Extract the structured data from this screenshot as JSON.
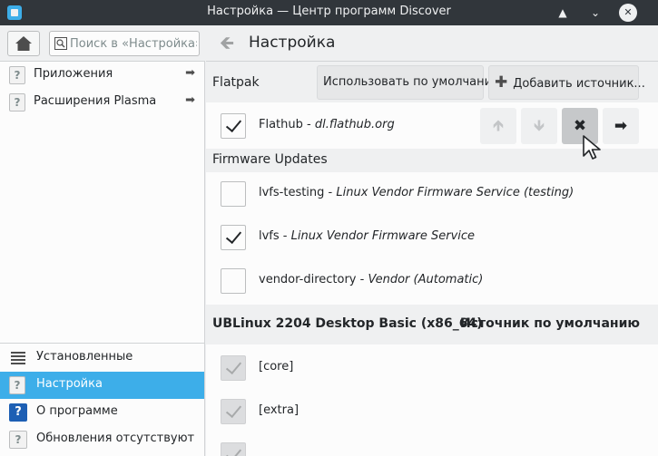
{
  "window": {
    "title": "Настройка — Центр программ Discover",
    "controls": [
      "▲",
      "⌄",
      "✕"
    ]
  },
  "sidebar": {
    "search_placeholder": "Поиск в «Настройка»…",
    "categories": [
      {
        "label": "Приложения",
        "icon": "question-mark-icon"
      },
      {
        "label": "Расширения Plasma",
        "icon": "question-mark-icon"
      }
    ],
    "bottom": [
      {
        "label": "Установленные",
        "icon": "list-icon"
      },
      {
        "label": "Настройка",
        "icon": "question-mark-icon",
        "active": true
      },
      {
        "label": "О программе",
        "icon": "about-icon"
      },
      {
        "label": "Обновления отсутствуют",
        "icon": "question-mark-icon"
      }
    ]
  },
  "header": {
    "title": "Настройка"
  },
  "flatpak": {
    "title": "Flatpak",
    "default_button": "Использовать по умолчанию",
    "add_button": "Добавить источник...",
    "sources": [
      {
        "name": "Flathub",
        "sep": " - ",
        "desc": "dl.flathub.org",
        "checked": true
      }
    ]
  },
  "firmware": {
    "title": "Firmware Updates",
    "sources": [
      {
        "name": "lvfs-testing",
        "sep": " - ",
        "desc": "Linux Vendor Firmware Service (testing)",
        "checked": false
      },
      {
        "name": "lvfs",
        "sep": " - ",
        "desc": "Linux Vendor Firmware Service",
        "checked": true
      },
      {
        "name": "vendor-directory",
        "sep": " - ",
        "desc": "Vendor (Automatic)",
        "checked": false
      }
    ]
  },
  "distro": {
    "title": "UBLinux 2204 Desktop Basic (x86_64)",
    "default_label": "Источник по умолчанию",
    "sources": [
      {
        "name": "[core]",
        "checked": true
      },
      {
        "name": "[extra]",
        "checked": true
      }
    ]
  },
  "colors": {
    "accent": "#3daee9",
    "titlebar": "#31363b",
    "background": "#eff0f1"
  }
}
